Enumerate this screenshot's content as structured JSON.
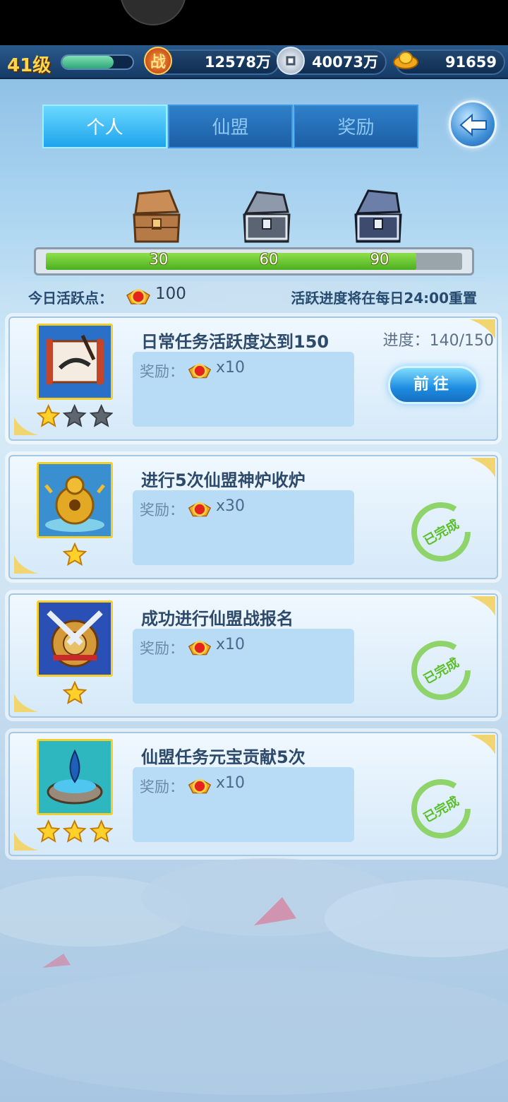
{
  "header": {
    "level": "41级",
    "xp_fraction": 0.73,
    "combat_power": "12578万",
    "silver": "40073万",
    "gold": "91659",
    "combat_icon_char": "战"
  },
  "tabs": [
    {
      "label": "个人",
      "active": true
    },
    {
      "label": "仙盟",
      "active": false
    },
    {
      "label": "奖励",
      "active": false
    }
  ],
  "chests": {
    "milestones": [
      "30",
      "60",
      "90"
    ],
    "progress_fraction": 0.89
  },
  "activity": {
    "label": "今日活跃点：",
    "value": "100",
    "note": "活跃进度将在每日24:00重置"
  },
  "tasks": [
    {
      "title": "日常任务活跃度达到150",
      "reward_label": "奖励：",
      "reward_count": "x10",
      "progress": "进度：140/150",
      "action": "前往",
      "stars_filled": 1,
      "stars_total": 3,
      "completed": false,
      "done_label": ""
    },
    {
      "title": "进行5次仙盟神炉收炉",
      "reward_label": "奖励：",
      "reward_count": "x30",
      "progress": "",
      "action": "",
      "stars_filled": 1,
      "stars_total": 1,
      "completed": true,
      "done_label": "已完成"
    },
    {
      "title": "成功进行仙盟战报名",
      "reward_label": "奖励：",
      "reward_count": "x10",
      "progress": "",
      "action": "",
      "stars_filled": 1,
      "stars_total": 1,
      "completed": true,
      "done_label": "已完成"
    },
    {
      "title": "仙盟任务元宝贡献5次",
      "reward_label": "奖励：",
      "reward_count": "x10",
      "progress": "",
      "action": "",
      "stars_filled": 3,
      "stars_total": 3,
      "completed": true,
      "done_label": "已完成"
    }
  ],
  "colors": {
    "accent": "#1ea4ec",
    "done_green": "#5bbf2a",
    "gold_text": "#ffd54a"
  }
}
